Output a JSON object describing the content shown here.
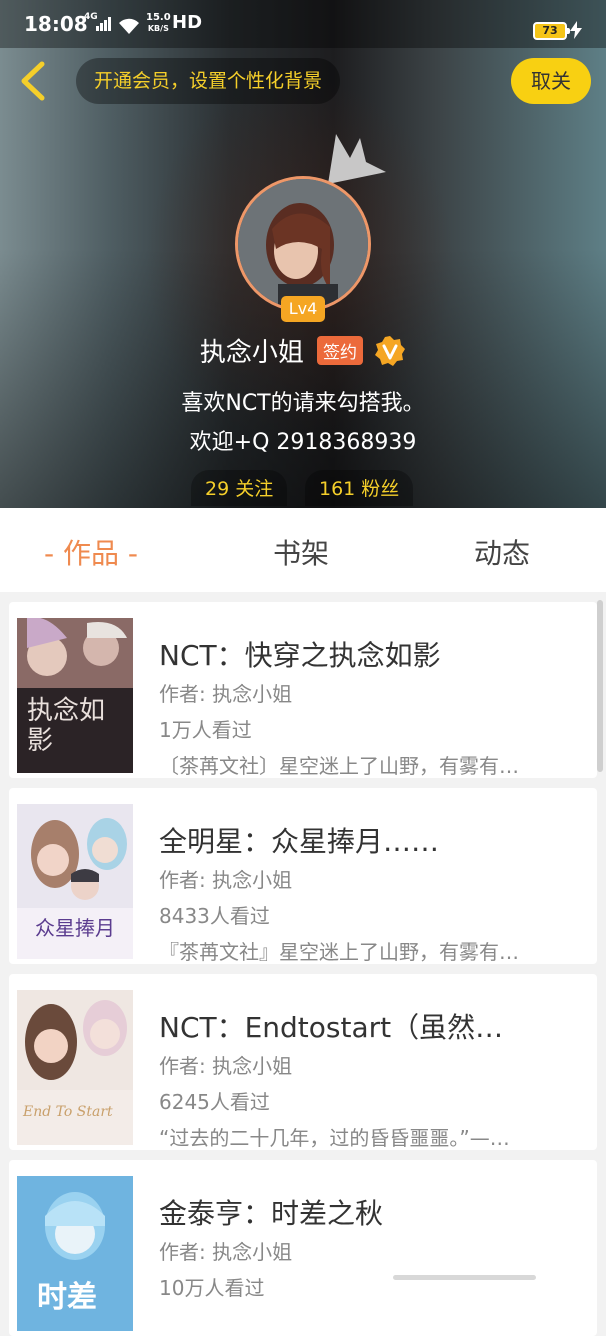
{
  "status_bar": {
    "time": "18:08",
    "network": "4G",
    "speed_value": "15.0",
    "speed_unit": "KB/S",
    "hd": "HD",
    "battery": "73"
  },
  "header": {
    "vip_banner": "开通会员，设置个性化背景",
    "unfollow_label": "取关"
  },
  "profile": {
    "level": "Lv4",
    "name": "执念小姐",
    "sign_tag": "签约",
    "bio_line1": "喜欢NCT的请来勾搭我。",
    "bio_line2": "欢迎+Q 2918368939",
    "following": "29 关注",
    "fans": "161 粉丝"
  },
  "tabs": {
    "works": "- 作品 -",
    "shelf": "书架",
    "feed": "动态"
  },
  "books": [
    {
      "title": "NCT：快穿之执念如影",
      "author": "作者: 执念小姐",
      "views": "1万人看过",
      "desc": "〔茶苒文社〕星空迷上了山野，有雾有…",
      "cover_text": "执念如影"
    },
    {
      "title": "全明星：众星捧月……",
      "author": "作者: 执念小姐",
      "views": "8433人看过",
      "desc": "『茶苒文社』星空迷上了山野，有雾有…",
      "cover_text": "众星捧月"
    },
    {
      "title": "NCT：Endtostart（虽然…",
      "author": "作者: 执念小姐",
      "views": "6245人看过",
      "desc": "“过去的二十几年，过的昏昏噩噩。”—…",
      "cover_text": "End To Start"
    },
    {
      "title": "金泰亨：时差之秋",
      "author": "作者: 执念小姐",
      "views": "10万人看过",
      "desc": "",
      "cover_text": "时差"
    }
  ],
  "colors": {
    "accent_orange": "#ef8a4f",
    "vip_yellow": "#f8d012",
    "sign_tag": "#ec6a3b",
    "level_badge": "#f5a623"
  }
}
